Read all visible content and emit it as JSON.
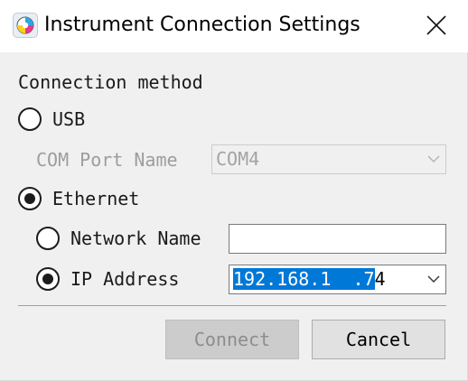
{
  "window": {
    "title": "Instrument Connection Settings",
    "icon": "app-logo-icon",
    "close_icon": "close-icon"
  },
  "connection": {
    "method_label": "Connection method",
    "usb": {
      "label": "USB",
      "checked": false,
      "com_port_label": "COM Port Name",
      "com_port_value": "COM4",
      "com_port_enabled": false
    },
    "ethernet": {
      "label": "Ethernet",
      "checked": true,
      "network_name": {
        "label": "Network Name",
        "checked": false,
        "value": ""
      },
      "ip_address": {
        "label": "IP Address",
        "checked": true,
        "value_selected": "192.168.1  .7",
        "value_rest": "4"
      }
    }
  },
  "buttons": {
    "connect": "Connect",
    "connect_enabled": false,
    "cancel": "Cancel"
  },
  "colors": {
    "selection": "#0078d7",
    "window_bg": "#f0f0f0"
  }
}
